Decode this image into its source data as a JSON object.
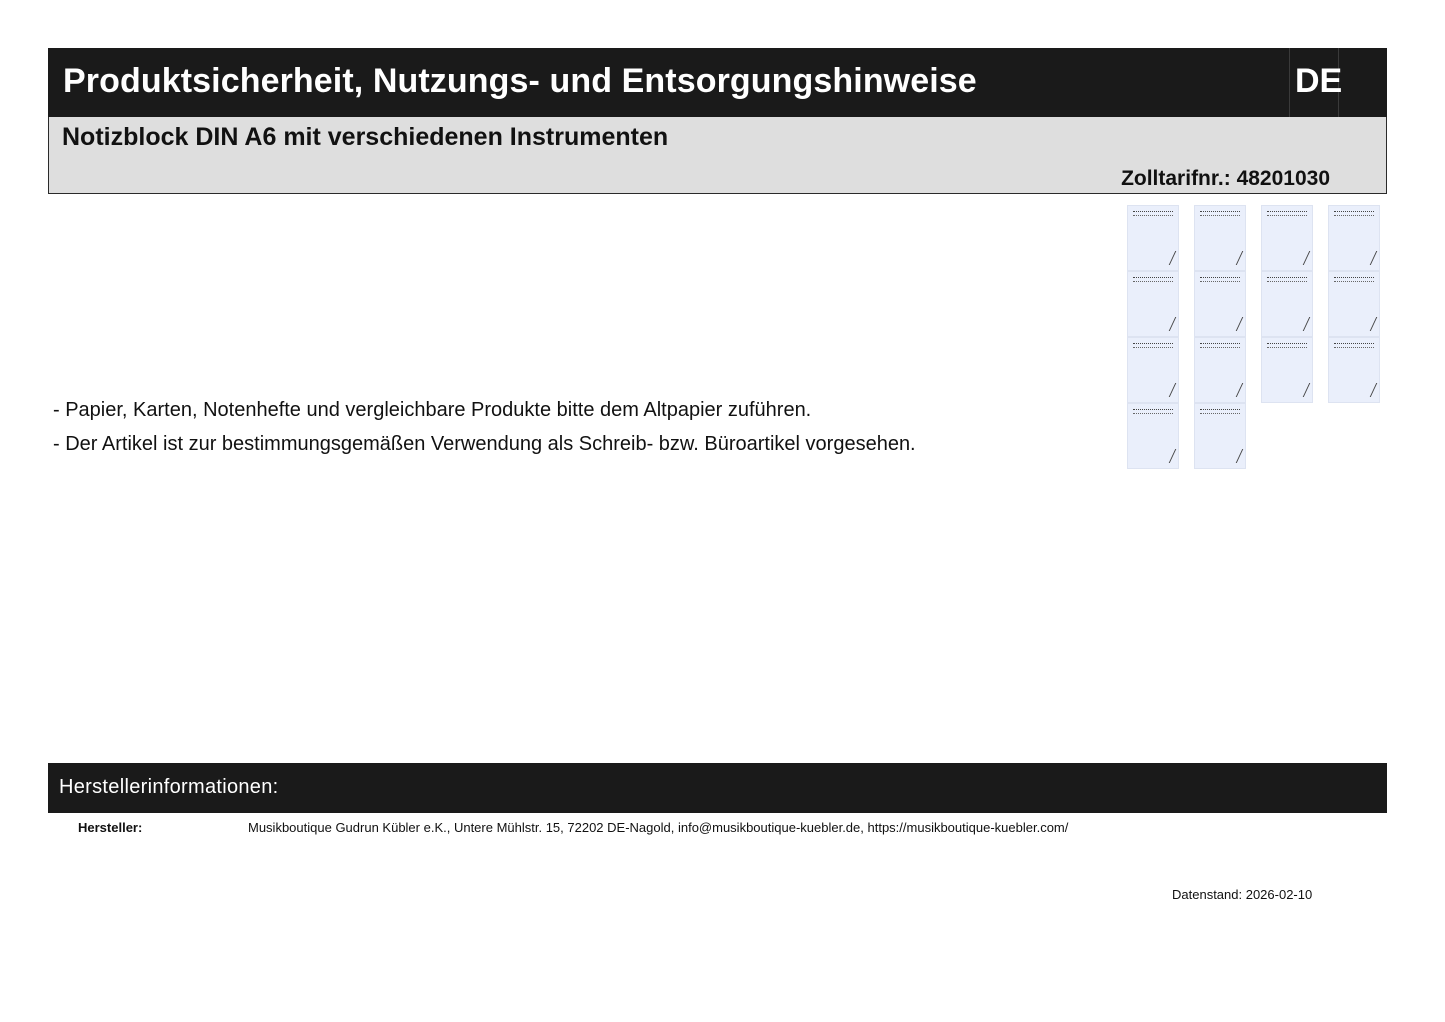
{
  "header": {
    "title": "Produktsicherheit, Nutzungs- und Entsorgungshinweise",
    "language": "DE"
  },
  "product": {
    "name": "Notizblock DIN A6 mit verschiedenen Instrumenten",
    "tariff": "Zolltarifnr.: 48201030"
  },
  "notes": [
    "- Papier, Karten, Notenhefte und vergleichbare Produkte bitte dem Altpapier zuführen.",
    "- Der Artikel ist zur bestimmungsgemäßen Verwendung als Schreib- bzw. Büroartikel vorgesehen."
  ],
  "product_images": {
    "count": 14,
    "description_icon": "notepad-thumbnail-icon"
  },
  "manufacturer": {
    "section_title": "Herstellerinformationen:",
    "label": "Hersteller:",
    "value": "Musikboutique Gudrun Kübler e.K., Untere Mühlstr. 15, 72202 DE-Nagold, info@musikboutique-kuebler.de, https://musikboutique-kuebler.com/"
  },
  "footer": {
    "date": "Datenstand: 2026-02-10"
  }
}
